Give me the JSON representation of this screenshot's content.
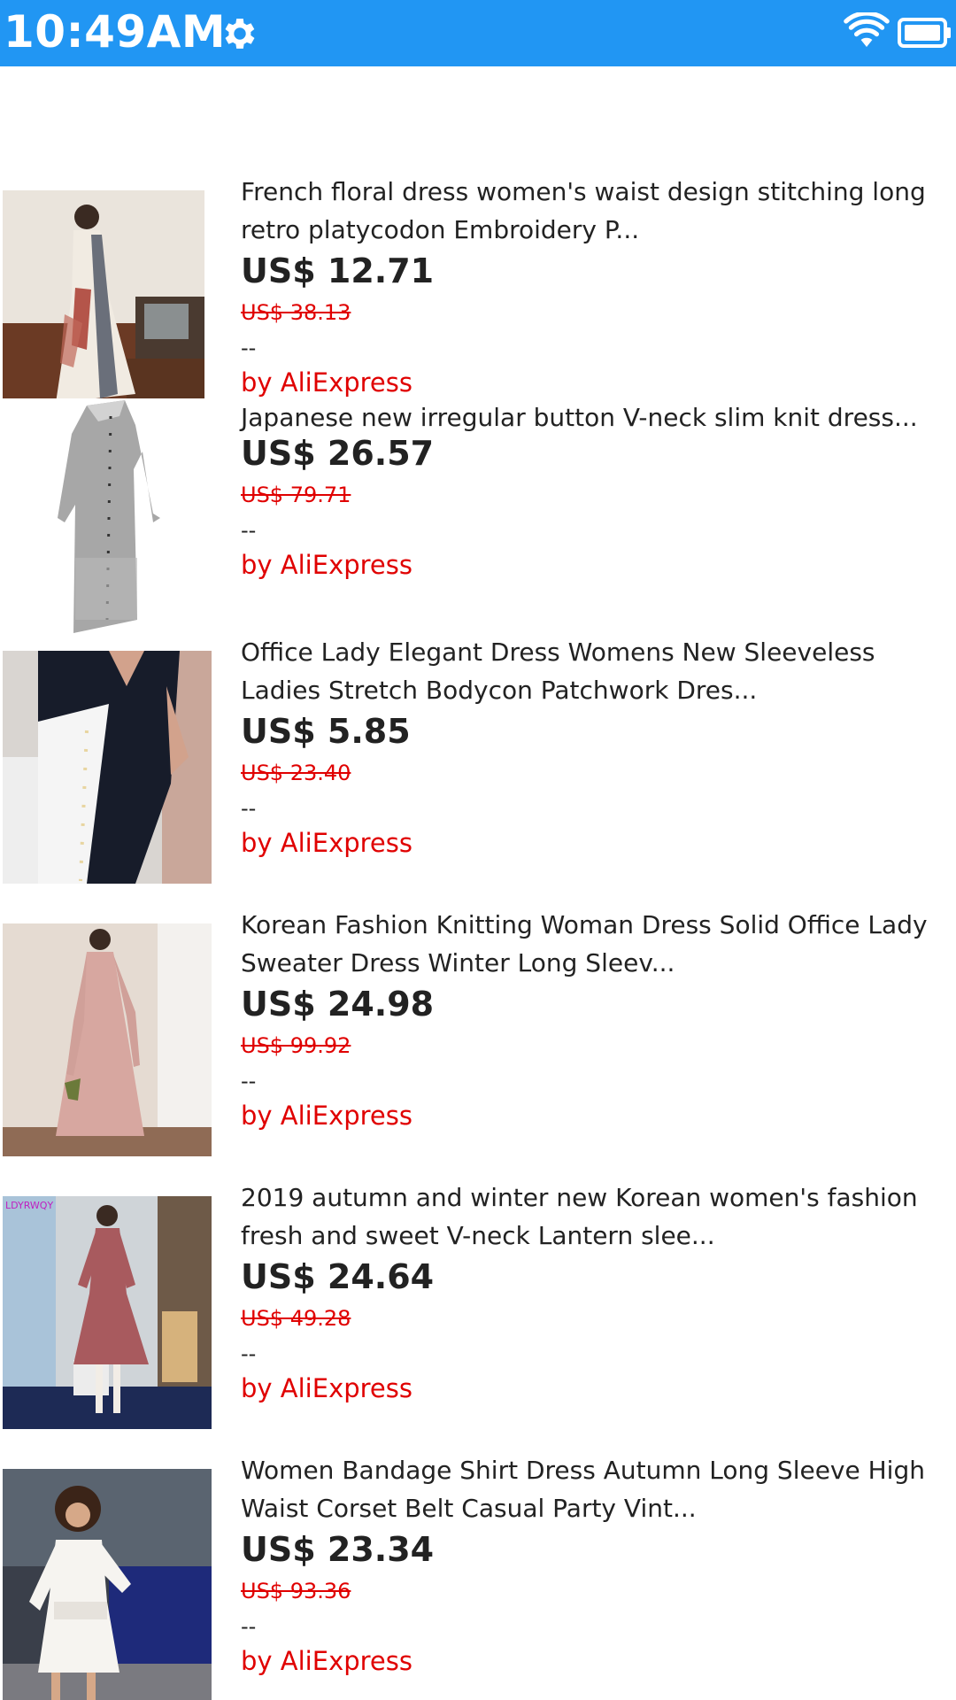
{
  "status_bar": {
    "time": "10:49AM",
    "icons": [
      "gear-icon",
      "wifi-icon",
      "battery-icon"
    ],
    "background": "#2196F3"
  },
  "colors": {
    "accent": "#e00000",
    "text": "#222222"
  },
  "products": [
    {
      "title_line1": "French floral dress women's waist design stitching long",
      "title_line2": "retro platycodon Embroidery P...",
      "price": "US$ 12.71",
      "original_price": "US$ 38.13",
      "extra": "--",
      "seller": "by AliExpress"
    },
    {
      "title_line1": "Japanese new irregular button V-neck slim knit dress...",
      "title_line2": "",
      "price": "US$ 26.57",
      "original_price": "US$ 79.71",
      "extra": "--",
      "seller": "by AliExpress"
    },
    {
      "title_line1": "Office Lady Elegant Dress Womens New Sleeveless",
      "title_line2": "Ladies Stretch Bodycon Patchwork Dres...",
      "price": "US$ 5.85",
      "original_price": "US$ 23.40",
      "extra": "--",
      "seller": "by AliExpress"
    },
    {
      "title_line1": "Korean Fashion Knitting Woman Dress Solid Office Lady",
      "title_line2": "Sweater Dress Winter Long Sleev...",
      "price": "US$ 24.98",
      "original_price": "US$ 99.92",
      "extra": "--",
      "seller": "by AliExpress"
    },
    {
      "title_line1": "2019 autumn and winter new Korean women's fashion",
      "title_line2": "fresh and sweet V-neck Lantern slee...",
      "price": "US$ 24.64",
      "original_price": "US$ 49.28",
      "extra": "--",
      "seller": "by AliExpress",
      "image_watermark": "LDYRWQY"
    },
    {
      "title_line1": "Women Bandage Shirt Dress Autumn Long Sleeve High",
      "title_line2": "Waist Corset Belt Casual Party Vint...",
      "price": "US$ 23.34",
      "original_price": "US$ 93.36",
      "extra": "--",
      "seller": "by AliExpress"
    }
  ]
}
